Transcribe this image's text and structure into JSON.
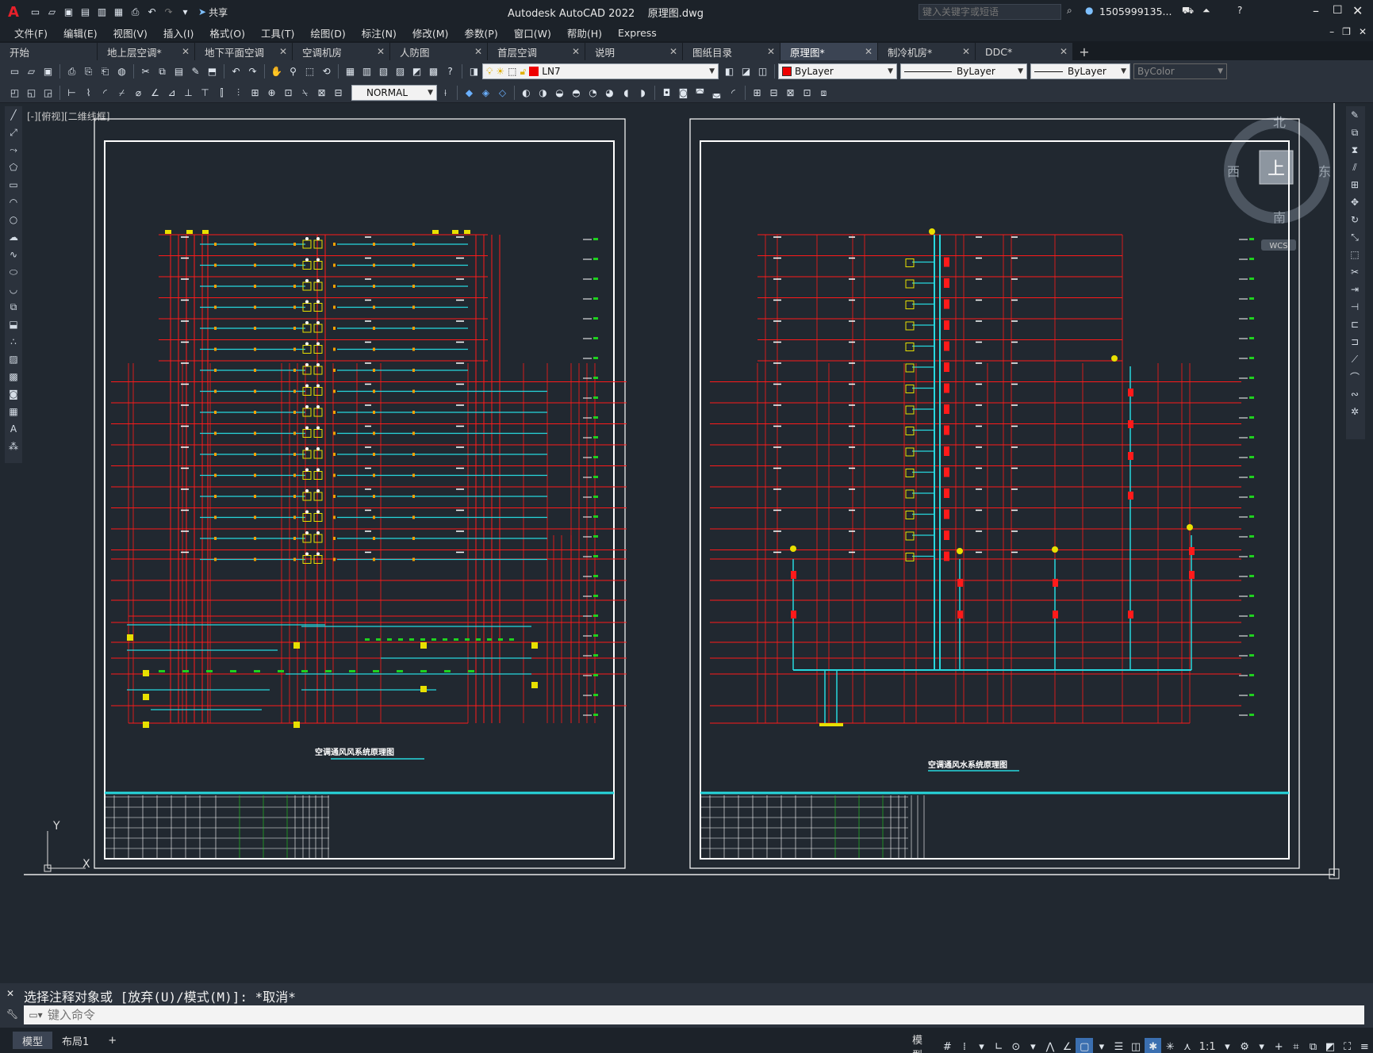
{
  "titlebar": {
    "app_title": "Autodesk AutoCAD 2022",
    "doc_title": "原理图.dwg",
    "share_label": "共享",
    "search_placeholder": "键入关键字或短语",
    "user": "1505999135...",
    "logo_letter": "A"
  },
  "menu": [
    "文件(F)",
    "编辑(E)",
    "视图(V)",
    "插入(I)",
    "格式(O)",
    "工具(T)",
    "绘图(D)",
    "标注(N)",
    "修改(M)",
    "参数(P)",
    "窗口(W)",
    "帮助(H)",
    "Express"
  ],
  "tabs": [
    {
      "label": "开始"
    },
    {
      "label": "地上层空调*"
    },
    {
      "label": "地下平面空调"
    },
    {
      "label": "空调机房"
    },
    {
      "label": "人防图"
    },
    {
      "label": "首层空调"
    },
    {
      "label": "说明"
    },
    {
      "label": "图纸目录"
    },
    {
      "label": "原理图*",
      "active": true
    },
    {
      "label": "制冷机房*"
    },
    {
      "label": "DDC*"
    }
  ],
  "layers": {
    "current_layer": "LN7",
    "color": "ByLayer",
    "linetype": "ByLayer",
    "lineweight": "ByLayer",
    "plotstyle": "ByColor"
  },
  "dimstyle": "NORMAL",
  "viewport_label": "[-][俯视][二维线框]",
  "viewcube": {
    "north": "北",
    "south": "南",
    "east": "东",
    "west": "西",
    "top": "上",
    "wcs": "WCS"
  },
  "drawing": {
    "left_title": "空调通风风系统原理图",
    "right_title": "空调通风水系统原理图"
  },
  "axis": {
    "y": "Y",
    "x": "X"
  },
  "command": {
    "history": "选择注释对象或 [放弃(U)/模式(M)]: *取消*",
    "placeholder": "键入命令"
  },
  "status": {
    "model_tab": "模型",
    "layout_tab": "布局1",
    "model_label": "模型",
    "scale": "1:1"
  },
  "colors": {
    "red": "#ff1a1a",
    "cyan": "#27d8de",
    "yellow": "#e8e000",
    "green": "#1fd11f",
    "white": "#ffffff"
  }
}
